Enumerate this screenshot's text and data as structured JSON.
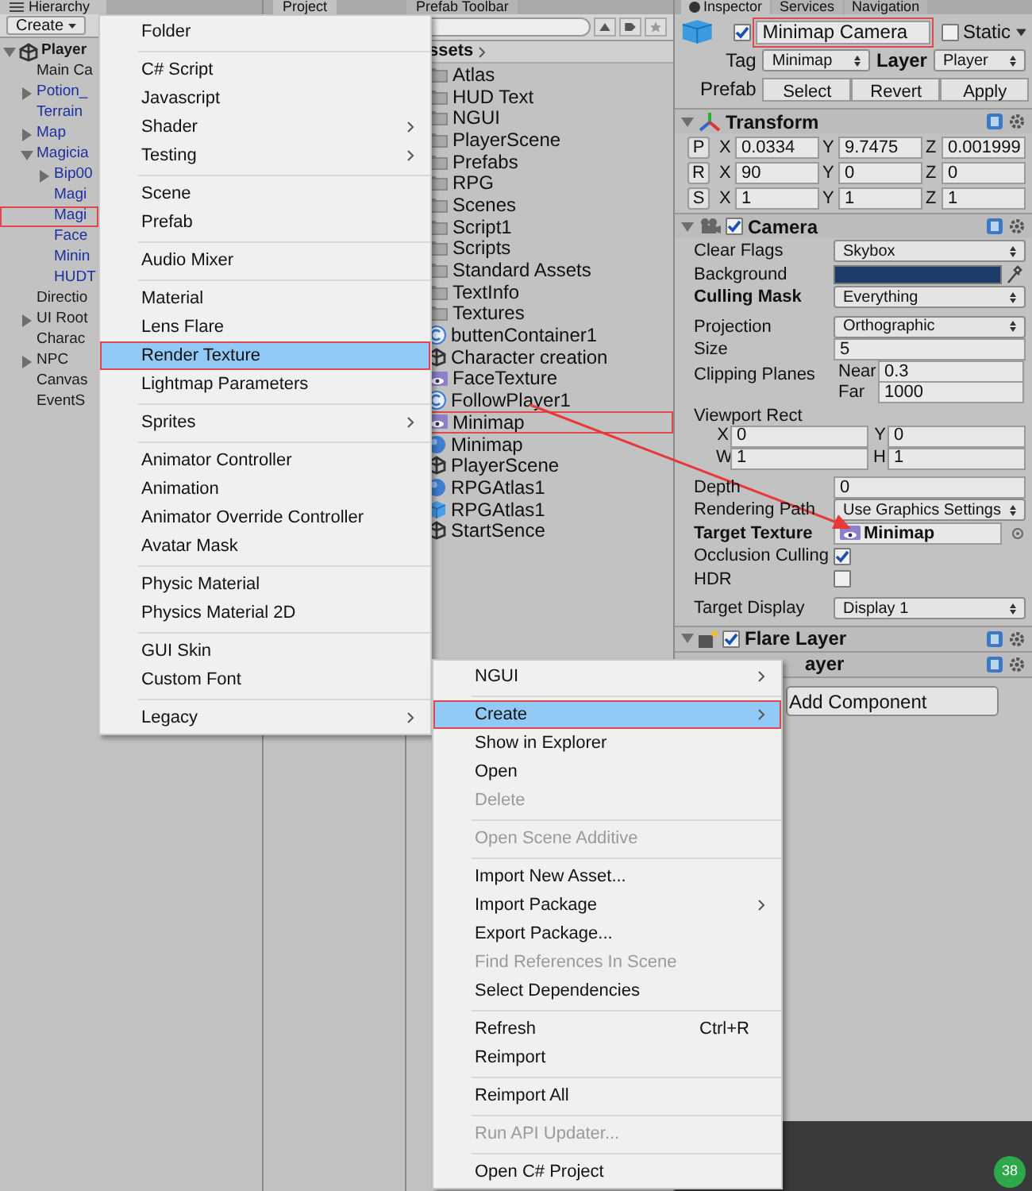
{
  "hierarchy": {
    "title": "Hierarchy",
    "create_button": "Create",
    "items": [
      {
        "label": "Player",
        "kind": "scene",
        "prefab": false,
        "marked": false,
        "expanded": true,
        "children": [
          {
            "label": "Main Ca",
            "prefab": false,
            "marked": false
          },
          {
            "label": "Potion_",
            "prefab": true,
            "marked": false,
            "expanded": false
          },
          {
            "label": "Terrain",
            "prefab": true,
            "marked": false
          },
          {
            "label": "Map",
            "prefab": true,
            "marked": false,
            "expanded": false
          },
          {
            "label": "Magicia",
            "prefab": true,
            "marked": false,
            "expanded": true,
            "children": [
              {
                "label": "Bip00",
                "prefab": true,
                "marked": false,
                "expanded": false
              },
              {
                "label": "Magi",
                "prefab": true,
                "marked": false
              },
              {
                "label": "Magi",
                "prefab": true,
                "marked": true
              },
              {
                "label": "Face",
                "prefab": true,
                "marked": false
              },
              {
                "label": "Minin",
                "prefab": true,
                "marked": false
              },
              {
                "label": "HUDT",
                "prefab": true,
                "marked": false
              }
            ]
          },
          {
            "label": "Directio",
            "prefab": false,
            "marked": false
          },
          {
            "label": "UI Root",
            "prefab": false,
            "marked": false,
            "expanded": false
          },
          {
            "label": "Charac",
            "prefab": false,
            "marked": false
          },
          {
            "label": "NPC",
            "prefab": false,
            "marked": false,
            "expanded": false
          },
          {
            "label": "Canvas",
            "prefab": false,
            "marked": false
          },
          {
            "label": "EventS",
            "prefab": false,
            "marked": false
          }
        ]
      }
    ]
  },
  "project": {
    "tabs": [
      {
        "label": "Project",
        "selected": true
      },
      {
        "label": "Prefab Toolbar",
        "selected": false
      }
    ],
    "breadcrumb": "ssets",
    "assets": [
      {
        "label": "Atlas",
        "kind": "folder",
        "marked": false
      },
      {
        "label": "HUD Text",
        "kind": "folder",
        "marked": false
      },
      {
        "label": "NGUI",
        "kind": "folder",
        "marked": false
      },
      {
        "label": "PlayerScene",
        "kind": "folder",
        "marked": false
      },
      {
        "label": "Prefabs",
        "kind": "folder",
        "marked": false
      },
      {
        "label": "RPG",
        "kind": "folder",
        "marked": false
      },
      {
        "label": "Scenes",
        "kind": "folder",
        "marked": false
      },
      {
        "label": "Script1",
        "kind": "folder",
        "marked": false
      },
      {
        "label": "Scripts",
        "kind": "folder",
        "marked": false
      },
      {
        "label": "Standard Assets",
        "kind": "folder",
        "marked": false
      },
      {
        "label": "TextInfo",
        "kind": "folder",
        "marked": false
      },
      {
        "label": "Textures",
        "kind": "folder",
        "marked": false
      },
      {
        "label": "buttenContainer1",
        "kind": "script",
        "marked": false
      },
      {
        "label": "Character creation",
        "kind": "scene",
        "marked": false
      },
      {
        "label": "FaceTexture",
        "kind": "texture",
        "marked": false
      },
      {
        "label": "FollowPlayer1",
        "kind": "script",
        "marked": false
      },
      {
        "label": "Minimap",
        "kind": "texture",
        "marked": true
      },
      {
        "label": "Minimap",
        "kind": "material",
        "marked": false
      },
      {
        "label": "PlayerScene",
        "kind": "scene",
        "marked": false
      },
      {
        "label": "RPGAtlas1",
        "kind": "material",
        "marked": false
      },
      {
        "label": "RPGAtlas1",
        "kind": "prefab",
        "marked": false
      },
      {
        "label": "StartSence",
        "kind": "scene",
        "marked": false
      }
    ]
  },
  "inspector": {
    "tabs": [
      {
        "label": "Inspector",
        "selected": true
      },
      {
        "label": "Services",
        "selected": false
      },
      {
        "label": "Navigation",
        "selected": false
      }
    ],
    "object": {
      "active": true,
      "name": "Minimap Camera",
      "name_marked": true,
      "static_label": "Static",
      "static": false,
      "tag_label": "Tag",
      "tag": "Minimap",
      "layer_label": "Layer",
      "layer": "Player",
      "prefab_label": "Prefab",
      "prefab_buttons": [
        "Select",
        "Revert",
        "Apply"
      ]
    },
    "transform": {
      "title": "Transform",
      "rows": [
        {
          "button": "P",
          "values": [
            {
              "axis": "X",
              "value": "0.0334"
            },
            {
              "axis": "Y",
              "value": "9.7475"
            },
            {
              "axis": "Z",
              "value": "0.001999"
            }
          ]
        },
        {
          "button": "R",
          "values": [
            {
              "axis": "X",
              "value": "90"
            },
            {
              "axis": "Y",
              "value": "0"
            },
            {
              "axis": "Z",
              "value": "0"
            }
          ]
        },
        {
          "button": "S",
          "values": [
            {
              "axis": "X",
              "value": "1"
            },
            {
              "axis": "Y",
              "value": "1"
            },
            {
              "axis": "Z",
              "value": "1"
            }
          ]
        }
      ]
    },
    "camera": {
      "title": "Camera",
      "enabled": true,
      "field_groups": [
        [
          {
            "kind": "dropdown",
            "label": "Clear Flags",
            "value": "Skybox",
            "modified": false
          },
          {
            "kind": "color",
            "label": "Background",
            "color": "#1e3c6a",
            "modified": false
          },
          {
            "kind": "dropdown",
            "label": "Culling Mask",
            "value": "Everything",
            "modified": true
          }
        ],
        [
          {
            "kind": "dropdown",
            "label": "Projection",
            "value": "Orthographic",
            "modified": false
          },
          {
            "kind": "text",
            "label": "Size",
            "value": "5",
            "modified": false
          },
          {
            "kind": "pair",
            "label": "Clipping Planes",
            "values": [
              {
                "axis": "Near",
                "value": "0.3"
              },
              {
                "axis": "Far",
                "value": "1000"
              }
            ],
            "modified": false
          },
          {
            "kind": "rect",
            "label": "Viewport Rect",
            "values": [
              {
                "axis": "X",
                "value": "0"
              },
              {
                "axis": "Y",
                "value": "0"
              },
              {
                "axis": "W",
                "value": "1"
              },
              {
                "axis": "H",
                "value": "1"
              }
            ],
            "modified": false
          }
        ],
        [
          {
            "kind": "text",
            "label": "Depth",
            "value": "0",
            "modified": false
          },
          {
            "kind": "dropdown",
            "label": "Rendering Path",
            "value": "Use Graphics Settings",
            "modified": false
          },
          {
            "kind": "object",
            "label": "Target Texture",
            "value": "Minimap",
            "modified": true
          },
          {
            "kind": "checkbox",
            "label": "Occlusion Culling",
            "checked": true,
            "modified": false
          },
          {
            "kind": "checkbox",
            "label": "HDR",
            "checked": false,
            "modified": false
          }
        ],
        [
          {
            "kind": "dropdown",
            "label": "Target Display",
            "value": "Display 1",
            "modified": false
          }
        ]
      ]
    },
    "components": [
      {
        "title": "Flare Layer",
        "enabled": true
      },
      {
        "title": "ayer"
      }
    ],
    "add_component": "Add Component",
    "badge": "38"
  },
  "create_menu": [
    {
      "kind": "item",
      "label": "Folder",
      "submenu": false,
      "selected": false,
      "marked": false
    },
    {
      "kind": "separator"
    },
    {
      "kind": "item",
      "label": "C# Script",
      "submenu": false,
      "selected": false,
      "marked": false
    },
    {
      "kind": "item",
      "label": "Javascript",
      "submenu": false,
      "selected": false,
      "marked": false
    },
    {
      "kind": "item",
      "label": "Shader",
      "submenu": true,
      "selected": false,
      "marked": false
    },
    {
      "kind": "item",
      "label": "Testing",
      "submenu": true,
      "selected": false,
      "marked": false
    },
    {
      "kind": "separator"
    },
    {
      "kind": "item",
      "label": "Scene",
      "submenu": false,
      "selected": false,
      "marked": false
    },
    {
      "kind": "item",
      "label": "Prefab",
      "submenu": false,
      "selected": false,
      "marked": false
    },
    {
      "kind": "separator"
    },
    {
      "kind": "item",
      "label": "Audio Mixer",
      "submenu": false,
      "selected": false,
      "marked": false
    },
    {
      "kind": "separator"
    },
    {
      "kind": "item",
      "label": "Material",
      "submenu": false,
      "selected": false,
      "marked": false
    },
    {
      "kind": "item",
      "label": "Lens Flare",
      "submenu": false,
      "selected": false,
      "marked": false
    },
    {
      "kind": "item",
      "label": "Render Texture",
      "submenu": false,
      "selected": true,
      "marked": true
    },
    {
      "kind": "item",
      "label": "Lightmap Parameters",
      "submenu": false,
      "selected": false,
      "marked": false
    },
    {
      "kind": "separator"
    },
    {
      "kind": "item",
      "label": "Sprites",
      "submenu": true,
      "selected": false,
      "marked": false
    },
    {
      "kind": "separator"
    },
    {
      "kind": "item",
      "label": "Animator Controller",
      "submenu": false,
      "selected": false,
      "marked": false
    },
    {
      "kind": "item",
      "label": "Animation",
      "submenu": false,
      "selected": false,
      "marked": false
    },
    {
      "kind": "item",
      "label": "Animator Override Controller",
      "submenu": false,
      "selected": false,
      "marked": false
    },
    {
      "kind": "item",
      "label": "Avatar Mask",
      "submenu": false,
      "selected": false,
      "marked": false
    },
    {
      "kind": "separator"
    },
    {
      "kind": "item",
      "label": "Physic Material",
      "submenu": false,
      "selected": false,
      "marked": false
    },
    {
      "kind": "item",
      "label": "Physics Material 2D",
      "submenu": false,
      "selected": false,
      "marked": false
    },
    {
      "kind": "separator"
    },
    {
      "kind": "item",
      "label": "GUI Skin",
      "submenu": false,
      "selected": false,
      "marked": false
    },
    {
      "kind": "item",
      "label": "Custom Font",
      "submenu": false,
      "selected": false,
      "marked": false
    },
    {
      "kind": "separator"
    },
    {
      "kind": "item",
      "label": "Legacy",
      "submenu": true,
      "selected": false,
      "marked": false
    }
  ],
  "context_menu": [
    {
      "kind": "item",
      "label": "NGUI",
      "submenu": true,
      "selected": false,
      "marked": false,
      "disabled": false
    },
    {
      "kind": "separator"
    },
    {
      "kind": "item",
      "label": "Create",
      "submenu": true,
      "selected": true,
      "marked": true,
      "disabled": false
    },
    {
      "kind": "item",
      "label": "Show in Explorer",
      "submenu": false,
      "selected": false,
      "marked": false,
      "disabled": false
    },
    {
      "kind": "item",
      "label": "Open",
      "submenu": false,
      "selected": false,
      "marked": false,
      "disabled": false
    },
    {
      "kind": "item",
      "label": "Delete",
      "submenu": false,
      "selected": false,
      "marked": false,
      "disabled": true
    },
    {
      "kind": "separator"
    },
    {
      "kind": "item",
      "label": "Open Scene Additive",
      "submenu": false,
      "selected": false,
      "marked": false,
      "disabled": true
    },
    {
      "kind": "separator"
    },
    {
      "kind": "item",
      "label": "Import New Asset...",
      "submenu": false,
      "selected": false,
      "marked": false,
      "disabled": false
    },
    {
      "kind": "item",
      "label": "Import Package",
      "submenu": true,
      "selected": false,
      "marked": false,
      "disabled": false
    },
    {
      "kind": "item",
      "label": "Export Package...",
      "submenu": false,
      "selected": false,
      "marked": false,
      "disabled": false
    },
    {
      "kind": "item",
      "label": "Find References In Scene",
      "submenu": false,
      "selected": false,
      "marked": false,
      "disabled": true
    },
    {
      "kind": "item",
      "label": "Select Dependencies",
      "submenu": false,
      "selected": false,
      "marked": false,
      "disabled": false
    },
    {
      "kind": "separator"
    },
    {
      "kind": "item",
      "label": "Refresh",
      "shortcut": "Ctrl+R",
      "submenu": false,
      "selected": false,
      "marked": false,
      "disabled": false
    },
    {
      "kind": "item",
      "label": "Reimport",
      "submenu": false,
      "selected": false,
      "marked": false,
      "disabled": false
    },
    {
      "kind": "separator"
    },
    {
      "kind": "item",
      "label": "Reimport All",
      "submenu": false,
      "selected": false,
      "marked": false,
      "disabled": false
    },
    {
      "kind": "separator"
    },
    {
      "kind": "item",
      "label": "Run API Updater...",
      "submenu": false,
      "selected": false,
      "marked": false,
      "disabled": true
    },
    {
      "kind": "separator"
    },
    {
      "kind": "item",
      "label": "Open C# Project",
      "submenu": false,
      "selected": false,
      "marked": false,
      "disabled": false
    }
  ]
}
